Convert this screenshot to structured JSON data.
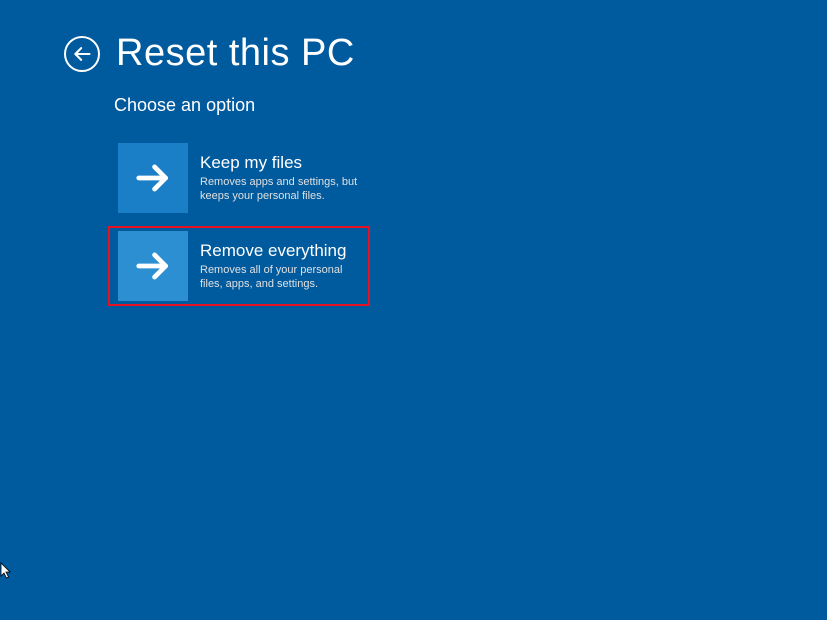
{
  "header": {
    "title": "Reset this PC"
  },
  "subtitle": "Choose an option",
  "options": [
    {
      "title": "Keep my files",
      "description": "Removes apps and settings, but keeps your personal files."
    },
    {
      "title": "Remove everything",
      "description": "Removes all of your personal files, apps, and settings."
    }
  ]
}
